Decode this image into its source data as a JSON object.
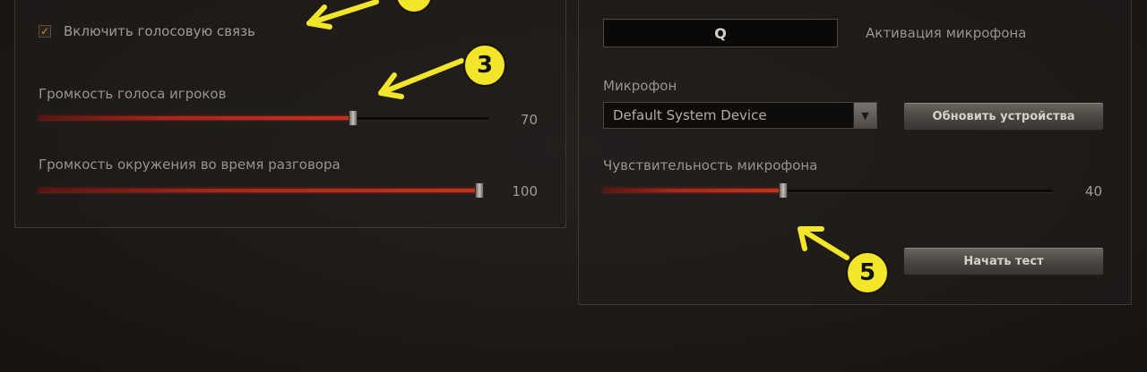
{
  "voice": {
    "enable_checkbox": {
      "label": "Включить голосовую связь",
      "checked": true,
      "check_glyph": "✓"
    },
    "players_volume": {
      "label": "Громкость голоса игроков",
      "value": 70,
      "max": 100,
      "display": "70"
    },
    "ambient_volume": {
      "label": "Громкость окружения во время разговора",
      "value": 100,
      "max": 100,
      "display": "100"
    }
  },
  "microphone": {
    "activation_key_value": "Q",
    "activation_key_label": "Активация микрофона",
    "device_label": "Микрофон",
    "device_selected": "Default System Device",
    "dropdown_arrow_icon": "triangle-down-icon",
    "refresh_button": "Обновить устройства",
    "sensitivity": {
      "label": "Чувствительность микрофона",
      "value": 40,
      "max": 100,
      "display": "40"
    },
    "test_button": "Начать тест"
  },
  "annotations": {
    "marker_3": "3",
    "marker_5": "5",
    "marker_color": "#f2e52a"
  },
  "colors": {
    "slider_fill": "#c8301e",
    "checkbox_check": "#e08a2a",
    "panel_border": "#3e3835"
  }
}
